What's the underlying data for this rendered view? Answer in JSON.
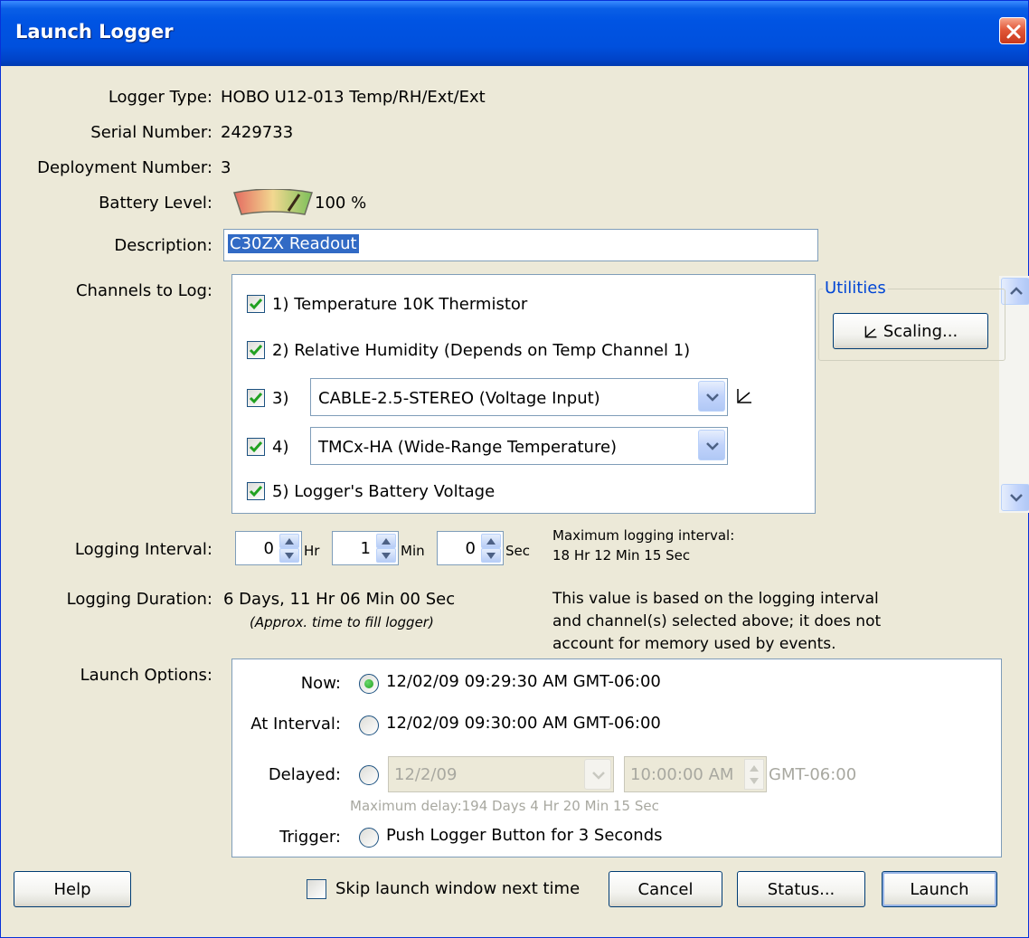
{
  "window": {
    "title": "Launch Logger",
    "close_icon": "close-icon"
  },
  "info": {
    "logger_type_label": "Logger Type:",
    "logger_type_value": "HOBO U12-013 Temp/RH/Ext/Ext",
    "serial_label": "Serial Number:",
    "serial_value": "2429733",
    "deployment_label": "Deployment Number:",
    "deployment_value": "3",
    "battery_label": "Battery Level:",
    "battery_value": "100 %",
    "battery_level_fraction": 1.0
  },
  "description": {
    "label": "Description:",
    "value": "C30ZX Readout"
  },
  "channels": {
    "label": "Channels to Log:",
    "items": [
      {
        "text": "1) Temperature 10K Thermistor",
        "checked": true
      },
      {
        "text": "2) Relative Humidity (Depends on Temp Channel 1)",
        "checked": true
      },
      {
        "text": "3)",
        "checked": true,
        "combo": "CABLE-2.5-STEREO (Voltage Input)",
        "has_scaling_icon": true
      },
      {
        "text": "4)",
        "checked": true,
        "combo": "TMCx-HA (Wide-Range Temperature)"
      },
      {
        "text": "5) Logger's Battery Voltage",
        "checked": true
      }
    ]
  },
  "utilities": {
    "title": "Utilities",
    "scaling_button": "Scaling..."
  },
  "logging_interval": {
    "label": "Logging Interval:",
    "hr_value": "0",
    "hr_unit": "Hr",
    "min_value": "1",
    "min_unit": "Min",
    "sec_value": "0",
    "sec_unit": "Sec",
    "max_line1": "Maximum logging interval:",
    "max_line2": "18 Hr 12 Min 15 Sec"
  },
  "logging_duration": {
    "label": "Logging Duration:",
    "value": "6 Days, 11 Hr 06 Min 00 Sec",
    "approx": "(Approx. time to fill logger)",
    "note_line1": "This value is based on the logging interval",
    "note_line2": "and channel(s) selected above; it does not",
    "note_line3": "account for memory used by events."
  },
  "launch_options": {
    "label": "Launch Options:",
    "now_label": "Now:",
    "now_value": "12/02/09 09:29:30 AM GMT-06:00",
    "now_selected": true,
    "interval_label": "At Interval:",
    "interval_value": "12/02/09 09:30:00 AM GMT-06:00",
    "delayed_label": "Delayed:",
    "delayed_date": "12/2/09",
    "delayed_time": "10:00:00 AM",
    "delayed_tz": "GMT-06:00",
    "max_delay": "Maximum delay:194 Days  4 Hr 20 Min 15 Sec",
    "trigger_label": "Trigger:",
    "trigger_value": "Push Logger Button for 3 Seconds"
  },
  "footer": {
    "help": "Help",
    "skip_label": "Skip launch window next time",
    "cancel": "Cancel",
    "status": "Status...",
    "launch": "Launch"
  }
}
